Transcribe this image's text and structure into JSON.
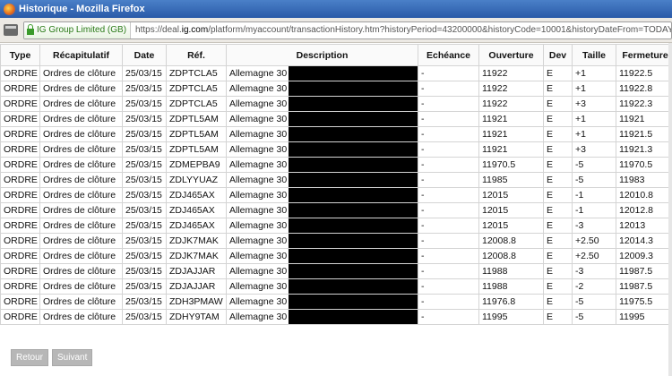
{
  "window": {
    "title": "Historique - Mozilla Firefox"
  },
  "urlbar": {
    "identity": "IG Group Limited (GB)",
    "url_prefix": "https://deal.",
    "url_host": "ig.com",
    "url_rest": "/platform/myaccount/transactionHistory.htm?historyPeriod=43200000&historyCode=10001&historyDateFrom=TODAY&historyDateT"
  },
  "table": {
    "headers": [
      "Type",
      "Récapitulatif",
      "Date",
      "Réf.",
      "Description",
      "Echéance",
      "Ouverture",
      "Dev",
      "Taille",
      "Fermeture"
    ],
    "rows": [
      [
        "ORDRE",
        "Ordres de clôture",
        "25/03/15",
        "ZDPTCLA5",
        "Allemagne 30",
        "-",
        "11922",
        "E",
        "+1",
        "11922.5"
      ],
      [
        "ORDRE",
        "Ordres de clôture",
        "25/03/15",
        "ZDPTCLA5",
        "Allemagne 30",
        "-",
        "11922",
        "E",
        "+1",
        "11922.8"
      ],
      [
        "ORDRE",
        "Ordres de clôture",
        "25/03/15",
        "ZDPTCLA5",
        "Allemagne 30",
        "-",
        "11922",
        "E",
        "+3",
        "11922.3"
      ],
      [
        "ORDRE",
        "Ordres de clôture",
        "25/03/15",
        "ZDPTL5AM",
        "Allemagne 30",
        "-",
        "11921",
        "E",
        "+1",
        "11921"
      ],
      [
        "ORDRE",
        "Ordres de clôture",
        "25/03/15",
        "ZDPTL5AM",
        "Allemagne 30",
        "-",
        "11921",
        "E",
        "+1",
        "11921.5"
      ],
      [
        "ORDRE",
        "Ordres de clôture",
        "25/03/15",
        "ZDPTL5AM",
        "Allemagne 30",
        "-",
        "11921",
        "E",
        "+3",
        "11921.3"
      ],
      [
        "ORDRE",
        "Ordres de clôture",
        "25/03/15",
        "ZDMEPBA9",
        "Allemagne 30",
        "-",
        "11970.5",
        "E",
        "-5",
        "11970.5"
      ],
      [
        "ORDRE",
        "Ordres de clôture",
        "25/03/15",
        "ZDLYYUAZ",
        "Allemagne 30",
        "-",
        "11985",
        "E",
        "-5",
        "11983"
      ],
      [
        "ORDRE",
        "Ordres de clôture",
        "25/03/15",
        "ZDJ465AX",
        "Allemagne 30",
        "-",
        "12015",
        "E",
        "-1",
        "12010.8"
      ],
      [
        "ORDRE",
        "Ordres de clôture",
        "25/03/15",
        "ZDJ465AX",
        "Allemagne 30",
        "-",
        "12015",
        "E",
        "-1",
        "12012.8"
      ],
      [
        "ORDRE",
        "Ordres de clôture",
        "25/03/15",
        "ZDJ465AX",
        "Allemagne 30",
        "-",
        "12015",
        "E",
        "-3",
        "12013"
      ],
      [
        "ORDRE",
        "Ordres de clôture",
        "25/03/15",
        "ZDJK7MAK",
        "Allemagne 30",
        "-",
        "12008.8",
        "E",
        "+2.50",
        "12014.3"
      ],
      [
        "ORDRE",
        "Ordres de clôture",
        "25/03/15",
        "ZDJK7MAK",
        "Allemagne 30",
        "-",
        "12008.8",
        "E",
        "+2.50",
        "12009.3"
      ],
      [
        "ORDRE",
        "Ordres de clôture",
        "25/03/15",
        "ZDJAJJAR",
        "Allemagne 30",
        "-",
        "11988",
        "E",
        "-3",
        "11987.5"
      ],
      [
        "ORDRE",
        "Ordres de clôture",
        "25/03/15",
        "ZDJAJJAR",
        "Allemagne 30",
        "-",
        "11988",
        "E",
        "-2",
        "11987.5"
      ],
      [
        "ORDRE",
        "Ordres de clôture",
        "25/03/15",
        "ZDH3PMAW",
        "Allemagne 30",
        "-",
        "11976.8",
        "E",
        "-5",
        "11975.5"
      ],
      [
        "ORDRE",
        "Ordres de clôture",
        "25/03/15",
        "ZDHY9TAM",
        "Allemagne 30",
        "-",
        "11995",
        "E",
        "-5",
        "11995"
      ]
    ]
  },
  "pagination": {
    "prev_label": "Retour",
    "next_label": "Suivant"
  }
}
